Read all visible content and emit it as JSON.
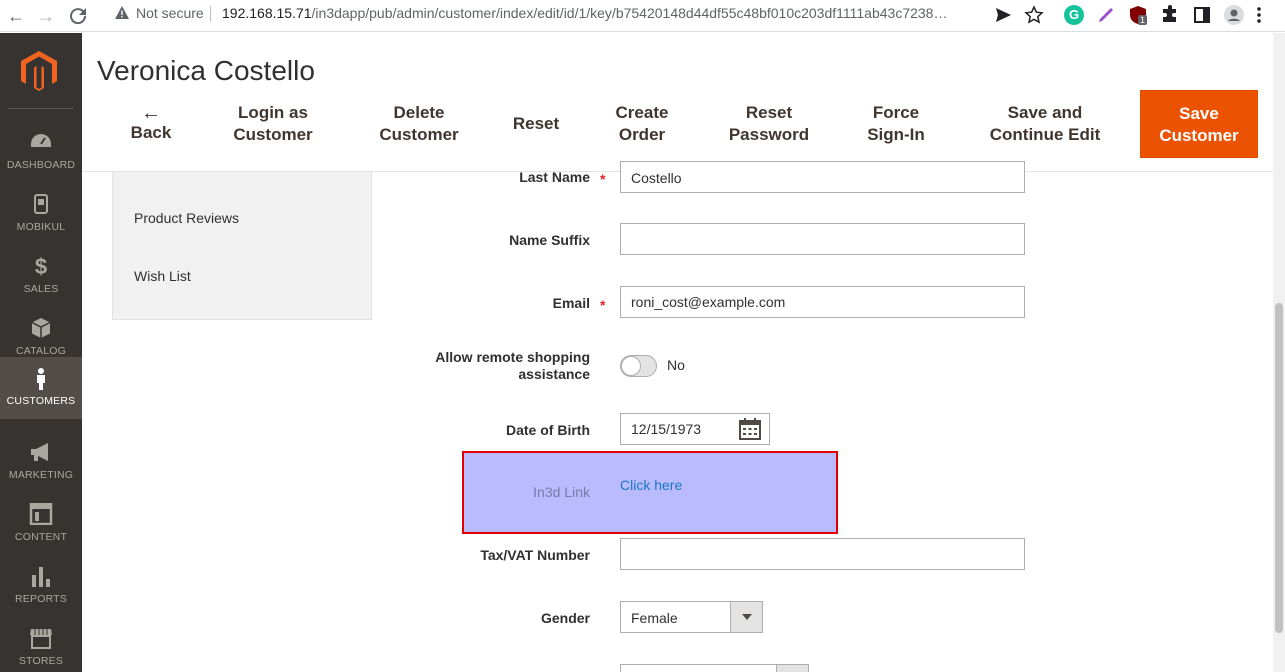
{
  "browser": {
    "security_label": "Not secure",
    "url_host": "192.168.15.71",
    "url_path": "/in3dapp/pub/admin/customer/index/edit/id/1/key/b75420148d44df55c48bf010c203df1111ab43c7238…",
    "ext_badge_count": "1",
    "ext_g_letter": "G"
  },
  "sidebar": {
    "items": [
      {
        "label": "DASHBOARD",
        "icon": "dashboard-icon"
      },
      {
        "label": "MOBIKUL",
        "icon": "mobikul-icon"
      },
      {
        "label": "SALES",
        "icon": "dollar-icon"
      },
      {
        "label": "CATALOG",
        "icon": "box-icon"
      },
      {
        "label": "CUSTOMERS",
        "icon": "person-icon",
        "active": true
      },
      {
        "label": "MARKETING",
        "icon": "megaphone-icon"
      },
      {
        "label": "CONTENT",
        "icon": "layout-icon"
      },
      {
        "label": "REPORTS",
        "icon": "bar-chart-icon"
      },
      {
        "label": "STORES",
        "icon": "store-icon"
      }
    ],
    "sales_glyph": "$"
  },
  "header": {
    "title": "Veronica Costello",
    "back_arrow": "←",
    "back_label": "Back",
    "login_as_customer": [
      "Login as",
      "Customer"
    ],
    "delete_customer": [
      "Delete",
      "Customer"
    ],
    "reset": "Reset",
    "create_order": [
      "Create",
      "Order"
    ],
    "reset_password": [
      "Reset",
      "Password"
    ],
    "force_sign_in": [
      "Force",
      "Sign-In"
    ],
    "save_continue": [
      "Save and",
      "Continue Edit"
    ],
    "save_customer": [
      "Save",
      "Customer"
    ]
  },
  "tabs": {
    "product_reviews": "Product Reviews",
    "wish_list": "Wish List"
  },
  "form": {
    "last_name": {
      "label": "Last Name",
      "value": "Costello",
      "required_mark": "*"
    },
    "name_suffix": {
      "label": "Name Suffix",
      "value": ""
    },
    "email": {
      "label": "Email",
      "value": "roni_cost@example.com",
      "required_mark": "*"
    },
    "remote_assistance": {
      "label_line1": "Allow remote shopping",
      "label_line2": "assistance",
      "value": "No",
      "enabled": false
    },
    "dob": {
      "label": "Date of Birth",
      "value": "12/15/1973"
    },
    "in3d_link": {
      "label": "In3d Link",
      "link_text": "Click here"
    },
    "tax_vat": {
      "label": "Tax/VAT Number",
      "value": ""
    },
    "gender": {
      "label": "Gender",
      "value": "Female"
    }
  },
  "colors": {
    "accent": "#eb5202",
    "sidebar_bg": "#373330",
    "highlight_bg": "#babaff",
    "highlight_border": "#e30000",
    "link": "#1979c3"
  }
}
